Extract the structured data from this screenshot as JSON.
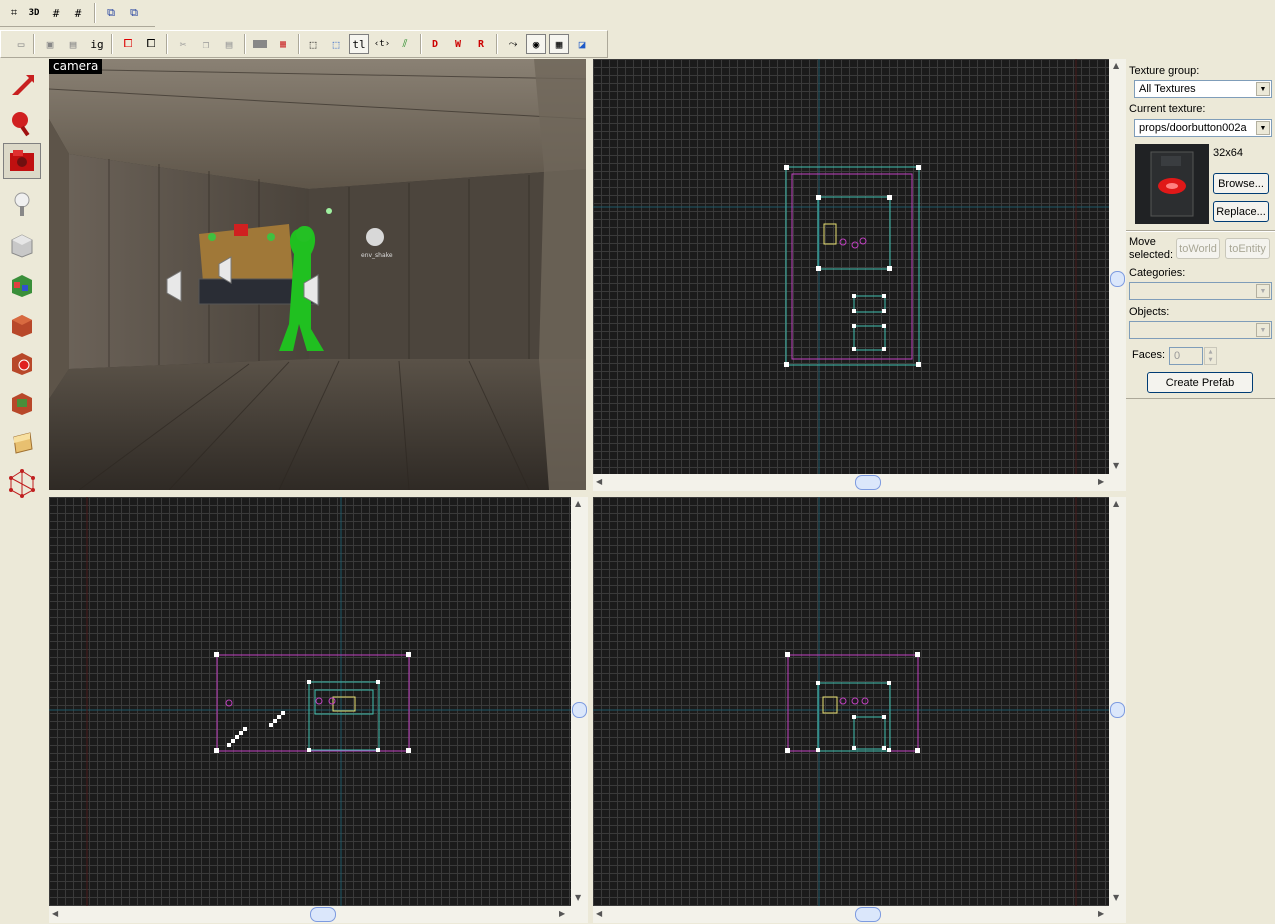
{
  "toolbar_top": {
    "buttons": [
      {
        "name": "grid-2d-icon",
        "glyph": "⌗"
      },
      {
        "name": "grid-3d-icon",
        "glyph": "3D"
      },
      {
        "name": "grid-smaller-icon",
        "glyph": "#-"
      },
      {
        "name": "grid-larger-icon",
        "glyph": "#+"
      },
      {
        "name": "group-icon",
        "glyph": "⧉"
      },
      {
        "name": "ungroup-icon",
        "glyph": "⧉"
      }
    ]
  },
  "toolbar_second": {
    "ignore_groups_label": "ig",
    "texture_lock_label": "tl",
    "buttons": [
      "undo-icon",
      "carve-icon",
      "hollow-icon",
      "ignore-groups-toggle",
      "group-select-icon",
      "ungroup-select-icon",
      "cut-icon",
      "copy-icon",
      "paste-icon",
      "hide-icon",
      "texture-lock-icon",
      "box-icon",
      "select-icon",
      "texture-lock-toggle",
      "texture-scale-icon",
      "flip-icon",
      "draw-mode-icon",
      "wire-mode-icon",
      "radial-mode-icon",
      "sample-icon",
      "texture-app-icon",
      "grid-3d-view-icon",
      "decals-icon"
    ]
  },
  "camera_view": {
    "label": "camera",
    "entity_label": "env_shake"
  },
  "right_panel": {
    "texture_group_label": "Texture group:",
    "texture_group_value": "All Textures",
    "current_texture_label": "Current texture:",
    "current_texture_value": "props/doorbutton002a",
    "texture_size": "32x64",
    "browse_label": "Browse...",
    "replace_label": "Replace...",
    "move_selected_label": "Move",
    "move_selected_label2": "selected:",
    "to_world_label": "toWorld",
    "to_entity_label": "toEntity",
    "categories_label": "Categories:",
    "categories_value": "",
    "objects_label": "Objects:",
    "objects_value": "",
    "faces_label": "Faces:",
    "faces_value": "0",
    "create_prefab_label": "Create Prefab"
  },
  "colors": {
    "grid_bg": "#1b1b1b",
    "grid_line": "#3a3a3a",
    "brush_magenta": "#c040c0",
    "brush_cyan": "#40c0b0",
    "brush_yellow": "#e8e070",
    "axis_line": "#1d5a6a"
  }
}
